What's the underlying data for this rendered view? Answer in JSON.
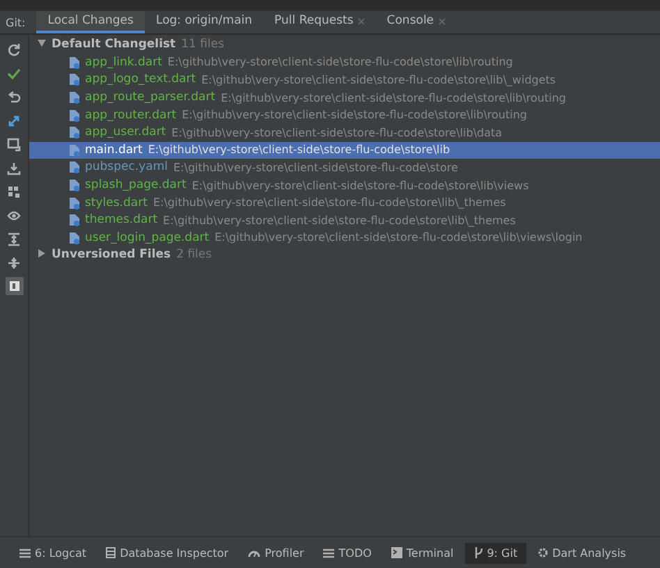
{
  "panel_title": "Git:",
  "tabs": [
    {
      "label": "Local Changes",
      "selected": true,
      "closable": false
    },
    {
      "label": "Log: origin/main",
      "selected": false,
      "closable": false
    },
    {
      "label": "Pull Requests",
      "selected": false,
      "closable": true
    },
    {
      "label": "Console",
      "selected": false,
      "closable": true
    }
  ],
  "toolbar": [
    {
      "kind": "refresh"
    },
    {
      "kind": "commit"
    },
    {
      "kind": "rollback"
    },
    {
      "kind": "shelve"
    },
    {
      "kind": "diff"
    },
    {
      "kind": "download"
    },
    {
      "kind": "group"
    },
    {
      "kind": "eye"
    },
    {
      "kind": "expand"
    },
    {
      "kind": "collapse"
    },
    {
      "kind": "preview"
    }
  ],
  "tree": [
    {
      "label": "Default Changelist",
      "count": "11 files",
      "expanded": true,
      "children": [
        {
          "name": "app_link.dart",
          "path": "E:\\github\\very-store\\client-side\\store-flu-code\\store\\lib\\routing",
          "kind": "added",
          "selected": false
        },
        {
          "name": "app_logo_text.dart",
          "path": "E:\\github\\very-store\\client-side\\store-flu-code\\store\\lib\\_widgets",
          "kind": "added",
          "selected": false
        },
        {
          "name": "app_route_parser.dart",
          "path": "E:\\github\\very-store\\client-side\\store-flu-code\\store\\lib\\routing",
          "kind": "added",
          "selected": false
        },
        {
          "name": "app_router.dart",
          "path": "E:\\github\\very-store\\client-side\\store-flu-code\\store\\lib\\routing",
          "kind": "added",
          "selected": false
        },
        {
          "name": "app_user.dart",
          "path": "E:\\github\\very-store\\client-side\\store-flu-code\\store\\lib\\data",
          "kind": "added",
          "selected": false
        },
        {
          "name": "main.dart",
          "path": "E:\\github\\very-store\\client-side\\store-flu-code\\store\\lib",
          "kind": "modified",
          "selected": true
        },
        {
          "name": "pubspec.yaml",
          "path": "E:\\github\\very-store\\client-side\\store-flu-code\\store",
          "kind": "modified",
          "selected": false
        },
        {
          "name": "splash_page.dart",
          "path": "E:\\github\\very-store\\client-side\\store-flu-code\\store\\lib\\views",
          "kind": "added",
          "selected": false
        },
        {
          "name": "styles.dart",
          "path": "E:\\github\\very-store\\client-side\\store-flu-code\\store\\lib\\_themes",
          "kind": "added",
          "selected": false
        },
        {
          "name": "themes.dart",
          "path": "E:\\github\\very-store\\client-side\\store-flu-code\\store\\lib\\_themes",
          "kind": "added",
          "selected": false
        },
        {
          "name": "user_login_page.dart",
          "path": "E:\\github\\very-store\\client-side\\store-flu-code\\store\\lib\\views\\login",
          "kind": "added",
          "selected": false
        }
      ]
    },
    {
      "label": "Unversioned Files",
      "count": "2 files",
      "expanded": false
    }
  ],
  "bottom_tabs": [
    {
      "label": "6: Logcat",
      "kind": "list",
      "selected": false
    },
    {
      "label": "Database Inspector",
      "kind": "database",
      "selected": false
    },
    {
      "label": "Profiler",
      "kind": "gauge",
      "selected": false
    },
    {
      "label": "TODO",
      "kind": "list",
      "selected": false
    },
    {
      "label": "Terminal",
      "kind": "terminal",
      "selected": false
    },
    {
      "label": "9: Git",
      "kind": "branch",
      "selected": true
    },
    {
      "label": "Dart Analysis",
      "kind": "gear",
      "selected": false
    }
  ]
}
